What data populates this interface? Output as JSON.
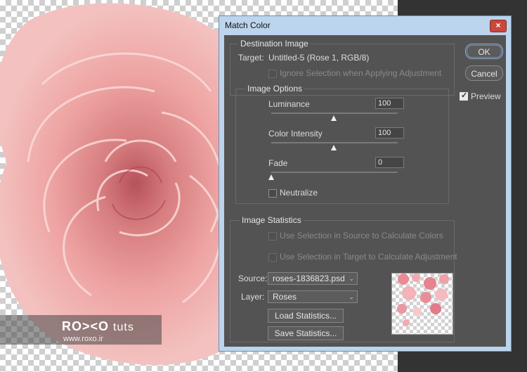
{
  "dialog": {
    "title": "Match Color",
    "close_label": "×",
    "ok_label": "OK",
    "cancel_label": "Cancel",
    "preview_label": "Preview",
    "preview_checked": true
  },
  "destination": {
    "legend": "Destination Image",
    "target_label": "Target:",
    "target_value": "Untitled-5 (Rose 1, RGB/8)",
    "ignore_selection_label": "Ignore Selection when Applying Adjustment"
  },
  "options": {
    "legend": "Image Options",
    "luminance_label": "Luminance",
    "luminance_value": "100",
    "luminance_fraction": 0.5,
    "intensity_label": "Color Intensity",
    "intensity_value": "100",
    "intensity_fraction": 0.5,
    "fade_label": "Fade",
    "fade_value": "0",
    "fade_fraction": 0.0,
    "neutralize_label": "Neutralize"
  },
  "statistics": {
    "legend": "Image Statistics",
    "use_source_label": "Use Selection in Source to Calculate Colors",
    "use_target_label": "Use Selection in Target to Calculate Adjustment",
    "source_label": "Source:",
    "source_value": "roses-1836823.psd",
    "layer_label": "Layer:",
    "layer_value": "Roses",
    "load_label": "Load Statistics...",
    "save_label": "Save Statistics..."
  },
  "watermark": {
    "logo": "RO><O",
    "tuts": "tuts",
    "url": "www.roxo.ir"
  },
  "colors": {
    "dialog_bg": "#535353",
    "title_bar": "#bcd4ec",
    "close_button": "#c9483c",
    "rose": "#ec9e9e"
  }
}
